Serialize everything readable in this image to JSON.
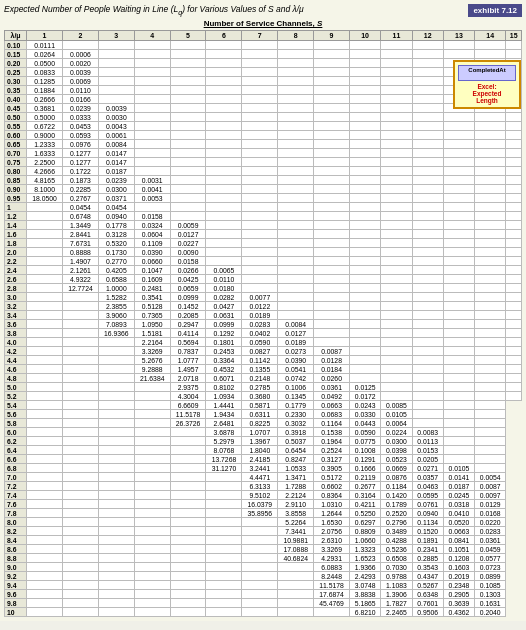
{
  "exhibit": {
    "badge": "exhibit 7.12",
    "title": "Expected Number of People Waiting in Line (Lₑ) for Various Values of S and λ/μ",
    "subtitle": "Number of Service Channels, S"
  },
  "highlight": {
    "label": "CompletedAt",
    "note": "Excel: Expected Length"
  },
  "columns": [
    "λ/μ",
    "1",
    "2",
    "3",
    "4",
    "5",
    "6",
    "7",
    "8",
    "9",
    "10",
    "11",
    "12",
    "13",
    "14",
    "15"
  ],
  "rows": [
    [
      "0.10",
      "0.0111",
      "",
      "",
      "",
      "",
      "",
      "",
      "",
      "",
      "",
      "",
      "",
      "",
      "",
      ""
    ],
    [
      "0.15",
      "0.0264",
      "0.0006",
      "",
      "",
      "",
      "",
      "",
      "",
      "",
      "",
      "",
      "",
      "",
      "",
      ""
    ],
    [
      "0.20",
      "0.0500",
      "0.0020",
      "",
      "",
      "",
      "",
      "",
      "",
      "",
      "",
      "",
      "",
      "",
      "",
      ""
    ],
    [
      "0.25",
      "0.0833",
      "0.0039",
      "",
      "",
      "",
      "",
      "",
      "",
      "",
      "",
      "",
      "",
      "",
      "",
      ""
    ],
    [
      "0.30",
      "0.1285",
      "0.0069",
      "",
      "",
      "",
      "",
      "",
      "",
      "",
      "",
      "",
      "",
      "",
      "",
      ""
    ],
    [
      "0.35",
      "0.1884",
      "0.0110",
      "",
      "",
      "",
      "",
      "",
      "",
      "",
      "",
      "",
      "",
      "",
      "",
      ""
    ],
    [
      "0.40",
      "0.2666",
      "0.0166",
      "",
      "",
      "",
      "",
      "",
      "",
      "",
      "",
      "",
      "",
      "",
      "",
      ""
    ],
    [
      "0.45",
      "0.3681",
      "0.0239",
      "0.0039",
      "",
      "",
      "",
      "",
      "",
      "",
      "",
      "",
      "",
      "",
      "",
      ""
    ],
    [
      "0.50",
      "0.5000",
      "0.0333",
      "0.0030",
      "",
      "",
      "",
      "",
      "",
      "",
      "",
      "",
      "",
      "",
      "",
      ""
    ],
    [
      "0.55",
      "0.6722",
      "0.0453",
      "0.0043",
      "",
      "",
      "",
      "",
      "",
      "",
      "",
      "",
      "",
      "",
      "",
      ""
    ],
    [
      "0.60",
      "0.9000",
      "0.0593",
      "0.0061",
      "",
      "",
      "",
      "",
      "",
      "",
      "",
      "",
      "",
      "",
      "",
      ""
    ],
    [
      "0.65",
      "1.2333",
      "0.0976",
      "0.0084",
      "",
      "",
      "",
      "",
      "",
      "",
      "",
      "",
      "",
      "",
      "",
      ""
    ],
    [
      "0.70",
      "1.6333",
      "0.1277",
      "0.0147",
      "",
      "",
      "",
      "",
      "",
      "",
      "",
      "",
      "",
      "",
      "",
      ""
    ],
    [
      "0.75",
      "2.2500",
      "0.1277",
      "0.0147",
      "",
      "",
      "",
      "",
      "",
      "",
      "",
      "",
      "",
      "",
      "",
      ""
    ],
    [
      "0.80",
      "4.2666",
      "0.1722",
      "0.0187",
      "",
      "",
      "",
      "",
      "",
      "",
      "",
      "",
      "",
      "",
      "",
      ""
    ],
    [
      "0.85",
      "4.8165",
      "0.1873",
      "0.0239",
      "0.0031",
      "",
      "",
      "",
      "",
      "",
      "",
      "",
      "",
      "",
      "",
      ""
    ],
    [
      "0.90",
      "8.1000",
      "0.2285",
      "0.0300",
      "0.0041",
      "",
      "",
      "",
      "",
      "",
      "",
      "",
      "",
      "",
      "",
      ""
    ],
    [
      "0.95",
      "18.0500",
      "0.2767",
      "0.0371",
      "0.0053",
      "",
      "",
      "",
      "",
      "",
      "",
      "",
      "",
      "",
      "",
      ""
    ],
    [
      "1",
      "",
      "0.0454",
      "0.0454",
      "",
      "",
      "",
      "",
      "",
      "",
      "",
      "",
      "",
      "",
      "",
      ""
    ],
    [
      "1.2",
      "",
      "0.6748",
      "0.0940",
      "0.0158",
      "",
      "",
      "",
      "",
      "",
      "",
      "",
      "",
      "",
      "",
      ""
    ],
    [
      "1.4",
      "",
      "1.3449",
      "0.1778",
      "0.0324",
      "0.0059",
      "",
      "",
      "",
      "",
      "",
      "",
      "",
      "",
      "",
      ""
    ],
    [
      "1.6",
      "",
      "2.8441",
      "0.3128",
      "0.0604",
      "0.0127",
      "",
      "",
      "",
      "",
      "",
      "",
      "",
      "",
      "",
      ""
    ],
    [
      "1.8",
      "",
      "7.6731",
      "0.5320",
      "0.1109",
      "0.0227",
      "",
      "",
      "",
      "",
      "",
      "",
      "",
      "",
      "",
      ""
    ],
    [
      "2.0",
      "",
      "0.8888",
      "0.1730",
      "0.0390",
      "0.0090",
      "",
      "",
      "",
      "",
      "",
      "",
      "",
      "",
      "",
      ""
    ],
    [
      "2.2",
      "",
      "1.4907",
      "0.2770",
      "0.0660",
      "0.0158",
      "",
      "",
      "",
      "",
      "",
      "",
      "",
      "",
      "",
      ""
    ],
    [
      "2.4",
      "",
      "2.1261",
      "0.4205",
      "0.1047",
      "0.0266",
      "0.0065",
      "",
      "",
      "",
      "",
      "",
      "",
      "",
      "",
      ""
    ],
    [
      "2.6",
      "",
      "4.9322",
      "0.6588",
      "0.1609",
      "0.0425",
      "0.0110",
      "",
      "",
      "",
      "",
      "",
      "",
      "",
      "",
      ""
    ],
    [
      "2.8",
      "",
      "12.7724",
      "1.0000",
      "0.2481",
      "0.0659",
      "0.0180",
      "",
      "",
      "",
      "",
      "",
      "",
      "",
      "",
      ""
    ],
    [
      "3.0",
      "",
      "",
      "1.5282",
      "0.3541",
      "0.0999",
      "0.0282",
      "0.0077",
      "",
      "",
      "",
      "",
      "",
      "",
      "",
      ""
    ],
    [
      "3.2",
      "",
      "",
      "2.3855",
      "0.5128",
      "0.1452",
      "0.0427",
      "0.0122",
      "",
      "",
      "",
      "",
      "",
      "",
      "",
      ""
    ],
    [
      "3.4",
      "",
      "",
      "3.9060",
      "0.7365",
      "0.2085",
      "0.0631",
      "0.0189",
      "",
      "",
      "",
      "",
      "",
      "",
      "",
      ""
    ],
    [
      "3.6",
      "",
      "",
      "7.0893",
      "1.0950",
      "0.2947",
      "0.0999",
      "0.0283",
      "0.0084",
      "",
      "",
      "",
      "",
      "",
      "",
      ""
    ],
    [
      "3.8",
      "",
      "",
      "16.9366",
      "1.5181",
      "0.4114",
      "0.1292",
      "0.0402",
      "0.0127",
      "",
      "",
      "",
      "",
      "",
      "",
      ""
    ],
    [
      "4.0",
      "",
      "",
      "",
      "2.2164",
      "0.5694",
      "0.1801",
      "0.0590",
      "0.0189",
      "",
      "",
      "",
      "",
      "",
      "",
      ""
    ],
    [
      "4.2",
      "",
      "",
      "",
      "3.3269",
      "0.7837",
      "0.2453",
      "0.0827",
      "0.0273",
      "0.0087",
      "",
      "",
      "",
      "",
      "",
      ""
    ],
    [
      "4.4",
      "",
      "",
      "",
      "5.2676",
      "1.0777",
      "0.3364",
      "0.1142",
      "0.0390",
      "0.0128",
      "",
      "",
      "",
      "",
      "",
      ""
    ],
    [
      "4.6",
      "",
      "",
      "",
      "9.2888",
      "1.4957",
      "0.4532",
      "0.1355",
      "0.0541",
      "0.0184",
      "",
      "",
      "",
      "",
      "",
      ""
    ],
    [
      "4.8",
      "",
      "",
      "",
      "21.6384",
      "2.0718",
      "0.6071",
      "0.2148",
      "0.0742",
      "0.0260",
      "",
      "",
      "",
      "",
      "",
      ""
    ],
    [
      "5.0",
      "",
      "",
      "",
      "",
      "2.9375",
      "0.8102",
      "0.2785",
      "0.1006",
      "0.0361",
      "0.0125",
      "",
      "",
      "",
      "",
      ""
    ],
    [
      "5.2",
      "",
      "",
      "",
      "",
      "4.3004",
      "1.0934",
      "0.3680",
      "0.1345",
      "0.0492",
      "0.0172",
      "",
      "",
      "",
      "",
      ""
    ],
    [
      "5.4",
      "",
      "",
      "",
      "",
      "6.6609",
      "1.4441",
      "0.5871",
      "0.1779",
      "0.0663",
      "0.0243",
      "0.0085",
      "",
      "",
      ""
    ],
    [
      "5.6",
      "",
      "",
      "",
      "",
      "11.5178",
      "1.9434",
      "0.6311",
      "0.2330",
      "0.0683",
      "0.0330",
      "0.0105",
      "",
      "",
      ""
    ],
    [
      "5.8",
      "",
      "",
      "",
      "",
      "26.3726",
      "2.6481",
      "0.8225",
      "0.3032",
      "0.1164",
      "0.0443",
      "0.0064",
      "",
      "",
      ""
    ],
    [
      "6.0",
      "",
      "",
      "",
      "",
      "",
      "3.6878",
      "1.0707",
      "0.3918",
      "0.1538",
      "0.0590",
      "0.0224",
      "0.0083",
      "",
      ""
    ],
    [
      "6.2",
      "",
      "",
      "",
      "",
      "",
      "5.2979",
      "1.3967",
      "0.5037",
      "0.1964",
      "0.0775",
      "0.0300",
      "0.0113",
      "",
      ""
    ],
    [
      "6.4",
      "",
      "",
      "",
      "",
      "",
      "8.0768",
      "1.8040",
      "0.6454",
      "0.2524",
      "0.1008",
      "0.0398",
      "0.0153",
      "",
      ""
    ],
    [
      "6.6",
      "",
      "",
      "",
      "",
      "",
      "13.7268",
      "2.4185",
      "0.8247",
      "0.3127",
      "0.1291",
      "0.0523",
      "0.0205",
      "",
      ""
    ],
    [
      "6.8",
      "",
      "",
      "",
      "",
      "",
      "31.1270",
      "3.2441",
      "1.0533",
      "0.3905",
      "0.1666",
      "0.0669",
      "0.0271",
      "0.0105",
      ""
    ],
    [
      "7.0",
      "",
      "",
      "",
      "",
      "",
      "",
      "4.4471",
      "1.3471",
      "0.5172",
      "0.2119",
      "0.0876",
      "0.0357",
      "0.0141",
      "0.0054"
    ],
    [
      "7.2",
      "",
      "",
      "",
      "",
      "",
      "",
      "6.3133",
      "1.7288",
      "0.6602",
      "0.2677",
      "0.1184",
      "0.0463",
      "0.0187",
      "0.0087"
    ],
    [
      "7.4",
      "",
      "",
      "",
      "",
      "",
      "",
      "9.5102",
      "2.2124",
      "0.8364",
      "0.3164",
      "0.1420",
      "0.0595",
      "0.0245",
      "0.0097"
    ],
    [
      "7.6",
      "",
      "",
      "",
      "",
      "",
      "",
      "16.0379",
      "2.9110",
      "1.0310",
      "0.4211",
      "0.1789",
      "0.0761",
      "0.0318",
      "0.0129"
    ],
    [
      "7.8",
      "",
      "",
      "",
      "",
      "",
      "",
      "35.8956",
      "3.8558",
      "1.2644",
      "0.5250",
      "0.2520",
      "0.0940",
      "0.0410",
      "0.0168"
    ],
    [
      "8.0",
      "",
      "",
      "",
      "",
      "",
      "",
      "",
      "5.2264",
      "1.6530",
      "0.6297",
      "0.2796",
      "0.1134",
      "0.0520",
      "0.0220"
    ],
    [
      "8.2",
      "",
      "",
      "",
      "",
      "",
      "",
      "",
      "7.3441",
      "2.0756",
      "0.8809",
      "0.3489",
      "0.1520",
      "0.0663",
      "0.0283"
    ],
    [
      "8.4",
      "",
      "",
      "",
      "",
      "",
      "",
      "",
      "10.9881",
      "2.6310",
      "1.0660",
      "0.4288",
      "0.1891",
      "0.0841",
      "0.0361"
    ],
    [
      "8.6",
      "",
      "",
      "",
      "",
      "",
      "",
      "",
      "17.0888",
      "3.3269",
      "1.3323",
      "0.5236",
      "0.2341",
      "0.1051",
      "0.0459"
    ],
    [
      "8.8",
      "",
      "",
      "",
      "",
      "",
      "",
      "",
      "40.6824",
      "4.2931",
      "1.6523",
      "0.6508",
      "0.2885",
      "0.1208",
      "0.0577"
    ],
    [
      "9.0",
      "",
      "",
      "",
      "",
      "",
      "",
      "",
      "",
      "6.0883",
      "1.9366",
      "0.7030",
      "0.3543",
      "0.1603",
      "0.0723"
    ],
    [
      "9.2",
      "",
      "",
      "",
      "",
      "",
      "",
      "",
      "",
      "8.2448",
      "2.4293",
      "0.9788",
      "0.4347",
      "0.2019",
      "0.0899"
    ],
    [
      "9.4",
      "",
      "",
      "",
      "",
      "",
      "",
      "",
      "",
      "11.5178",
      "3.0748",
      "1.1083",
      "0.5267",
      "0.2348",
      "0.1085"
    ],
    [
      "9.6",
      "",
      "",
      "",
      "",
      "",
      "",
      "",
      "",
      "17.6874",
      "3.8838",
      "1.3906",
      "0.6348",
      "0.2905",
      "0.1303"
    ],
    [
      "9.8",
      "",
      "",
      "",
      "",
      "",
      "",
      "",
      "",
      "45.4769",
      "5.1865",
      "1.7827",
      "0.7601",
      "0.3639",
      "0.1631"
    ],
    [
      "10",
      "",
      "",
      "",
      "",
      "",
      "",
      "",
      "",
      "",
      "6.8210",
      "2.2465",
      "0.9506",
      "0.4362",
      "0.2040"
    ]
  ]
}
